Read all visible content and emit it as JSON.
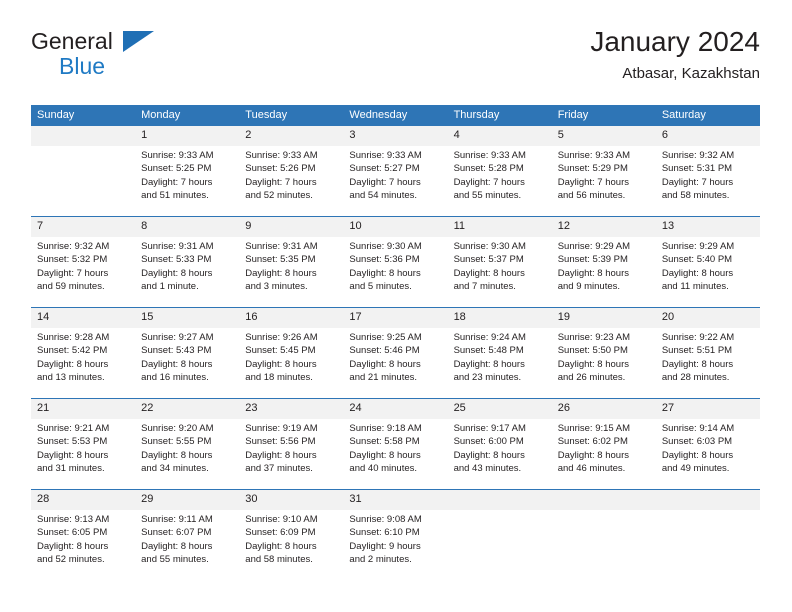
{
  "brand": {
    "name_part1": "General",
    "name_part2": "Blue",
    "triangle_color": "#1f6fb5",
    "blue_color": "#1f7ac4"
  },
  "header": {
    "title": "January 2024",
    "subtitle": "Atbasar, Kazakhstan"
  },
  "colors": {
    "header_row": "#2e75b6",
    "daynum_band": "#f2f2f2",
    "separator": "#2e75b6",
    "text": "#231f20"
  },
  "labels": {
    "sunrise_prefix": "Sunrise:",
    "sunset_prefix": "Sunset:",
    "daylight_prefix": "Daylight:"
  },
  "weekdays": [
    "Sunday",
    "Monday",
    "Tuesday",
    "Wednesday",
    "Thursday",
    "Friday",
    "Saturday"
  ],
  "weeks": [
    [
      {
        "day": "",
        "sunrise": "",
        "sunset": "",
        "daylight_line1": "",
        "daylight_line2": ""
      },
      {
        "day": "1",
        "sunrise": "Sunrise: 9:33 AM",
        "sunset": "Sunset: 5:25 PM",
        "daylight_line1": "Daylight: 7 hours",
        "daylight_line2": "and 51 minutes."
      },
      {
        "day": "2",
        "sunrise": "Sunrise: 9:33 AM",
        "sunset": "Sunset: 5:26 PM",
        "daylight_line1": "Daylight: 7 hours",
        "daylight_line2": "and 52 minutes."
      },
      {
        "day": "3",
        "sunrise": "Sunrise: 9:33 AM",
        "sunset": "Sunset: 5:27 PM",
        "daylight_line1": "Daylight: 7 hours",
        "daylight_line2": "and 54 minutes."
      },
      {
        "day": "4",
        "sunrise": "Sunrise: 9:33 AM",
        "sunset": "Sunset: 5:28 PM",
        "daylight_line1": "Daylight: 7 hours",
        "daylight_line2": "and 55 minutes."
      },
      {
        "day": "5",
        "sunrise": "Sunrise: 9:33 AM",
        "sunset": "Sunset: 5:29 PM",
        "daylight_line1": "Daylight: 7 hours",
        "daylight_line2": "and 56 minutes."
      },
      {
        "day": "6",
        "sunrise": "Sunrise: 9:32 AM",
        "sunset": "Sunset: 5:31 PM",
        "daylight_line1": "Daylight: 7 hours",
        "daylight_line2": "and 58 minutes."
      }
    ],
    [
      {
        "day": "7",
        "sunrise": "Sunrise: 9:32 AM",
        "sunset": "Sunset: 5:32 PM",
        "daylight_line1": "Daylight: 7 hours",
        "daylight_line2": "and 59 minutes."
      },
      {
        "day": "8",
        "sunrise": "Sunrise: 9:31 AM",
        "sunset": "Sunset: 5:33 PM",
        "daylight_line1": "Daylight: 8 hours",
        "daylight_line2": "and 1 minute."
      },
      {
        "day": "9",
        "sunrise": "Sunrise: 9:31 AM",
        "sunset": "Sunset: 5:35 PM",
        "daylight_line1": "Daylight: 8 hours",
        "daylight_line2": "and 3 minutes."
      },
      {
        "day": "10",
        "sunrise": "Sunrise: 9:30 AM",
        "sunset": "Sunset: 5:36 PM",
        "daylight_line1": "Daylight: 8 hours",
        "daylight_line2": "and 5 minutes."
      },
      {
        "day": "11",
        "sunrise": "Sunrise: 9:30 AM",
        "sunset": "Sunset: 5:37 PM",
        "daylight_line1": "Daylight: 8 hours",
        "daylight_line2": "and 7 minutes."
      },
      {
        "day": "12",
        "sunrise": "Sunrise: 9:29 AM",
        "sunset": "Sunset: 5:39 PM",
        "daylight_line1": "Daylight: 8 hours",
        "daylight_line2": "and 9 minutes."
      },
      {
        "day": "13",
        "sunrise": "Sunrise: 9:29 AM",
        "sunset": "Sunset: 5:40 PM",
        "daylight_line1": "Daylight: 8 hours",
        "daylight_line2": "and 11 minutes."
      }
    ],
    [
      {
        "day": "14",
        "sunrise": "Sunrise: 9:28 AM",
        "sunset": "Sunset: 5:42 PM",
        "daylight_line1": "Daylight: 8 hours",
        "daylight_line2": "and 13 minutes."
      },
      {
        "day": "15",
        "sunrise": "Sunrise: 9:27 AM",
        "sunset": "Sunset: 5:43 PM",
        "daylight_line1": "Daylight: 8 hours",
        "daylight_line2": "and 16 minutes."
      },
      {
        "day": "16",
        "sunrise": "Sunrise: 9:26 AM",
        "sunset": "Sunset: 5:45 PM",
        "daylight_line1": "Daylight: 8 hours",
        "daylight_line2": "and 18 minutes."
      },
      {
        "day": "17",
        "sunrise": "Sunrise: 9:25 AM",
        "sunset": "Sunset: 5:46 PM",
        "daylight_line1": "Daylight: 8 hours",
        "daylight_line2": "and 21 minutes."
      },
      {
        "day": "18",
        "sunrise": "Sunrise: 9:24 AM",
        "sunset": "Sunset: 5:48 PM",
        "daylight_line1": "Daylight: 8 hours",
        "daylight_line2": "and 23 minutes."
      },
      {
        "day": "19",
        "sunrise": "Sunrise: 9:23 AM",
        "sunset": "Sunset: 5:50 PM",
        "daylight_line1": "Daylight: 8 hours",
        "daylight_line2": "and 26 minutes."
      },
      {
        "day": "20",
        "sunrise": "Sunrise: 9:22 AM",
        "sunset": "Sunset: 5:51 PM",
        "daylight_line1": "Daylight: 8 hours",
        "daylight_line2": "and 28 minutes."
      }
    ],
    [
      {
        "day": "21",
        "sunrise": "Sunrise: 9:21 AM",
        "sunset": "Sunset: 5:53 PM",
        "daylight_line1": "Daylight: 8 hours",
        "daylight_line2": "and 31 minutes."
      },
      {
        "day": "22",
        "sunrise": "Sunrise: 9:20 AM",
        "sunset": "Sunset: 5:55 PM",
        "daylight_line1": "Daylight: 8 hours",
        "daylight_line2": "and 34 minutes."
      },
      {
        "day": "23",
        "sunrise": "Sunrise: 9:19 AM",
        "sunset": "Sunset: 5:56 PM",
        "daylight_line1": "Daylight: 8 hours",
        "daylight_line2": "and 37 minutes."
      },
      {
        "day": "24",
        "sunrise": "Sunrise: 9:18 AM",
        "sunset": "Sunset: 5:58 PM",
        "daylight_line1": "Daylight: 8 hours",
        "daylight_line2": "and 40 minutes."
      },
      {
        "day": "25",
        "sunrise": "Sunrise: 9:17 AM",
        "sunset": "Sunset: 6:00 PM",
        "daylight_line1": "Daylight: 8 hours",
        "daylight_line2": "and 43 minutes."
      },
      {
        "day": "26",
        "sunrise": "Sunrise: 9:15 AM",
        "sunset": "Sunset: 6:02 PM",
        "daylight_line1": "Daylight: 8 hours",
        "daylight_line2": "and 46 minutes."
      },
      {
        "day": "27",
        "sunrise": "Sunrise: 9:14 AM",
        "sunset": "Sunset: 6:03 PM",
        "daylight_line1": "Daylight: 8 hours",
        "daylight_line2": "and 49 minutes."
      }
    ],
    [
      {
        "day": "28",
        "sunrise": "Sunrise: 9:13 AM",
        "sunset": "Sunset: 6:05 PM",
        "daylight_line1": "Daylight: 8 hours",
        "daylight_line2": "and 52 minutes."
      },
      {
        "day": "29",
        "sunrise": "Sunrise: 9:11 AM",
        "sunset": "Sunset: 6:07 PM",
        "daylight_line1": "Daylight: 8 hours",
        "daylight_line2": "and 55 minutes."
      },
      {
        "day": "30",
        "sunrise": "Sunrise: 9:10 AM",
        "sunset": "Sunset: 6:09 PM",
        "daylight_line1": "Daylight: 8 hours",
        "daylight_line2": "and 58 minutes."
      },
      {
        "day": "31",
        "sunrise": "Sunrise: 9:08 AM",
        "sunset": "Sunset: 6:10 PM",
        "daylight_line1": "Daylight: 9 hours",
        "daylight_line2": "and 2 minutes."
      },
      {
        "day": "",
        "sunrise": "",
        "sunset": "",
        "daylight_line1": "",
        "daylight_line2": ""
      },
      {
        "day": "",
        "sunrise": "",
        "sunset": "",
        "daylight_line1": "",
        "daylight_line2": ""
      },
      {
        "day": "",
        "sunrise": "",
        "sunset": "",
        "daylight_line1": "",
        "daylight_line2": ""
      }
    ]
  ]
}
